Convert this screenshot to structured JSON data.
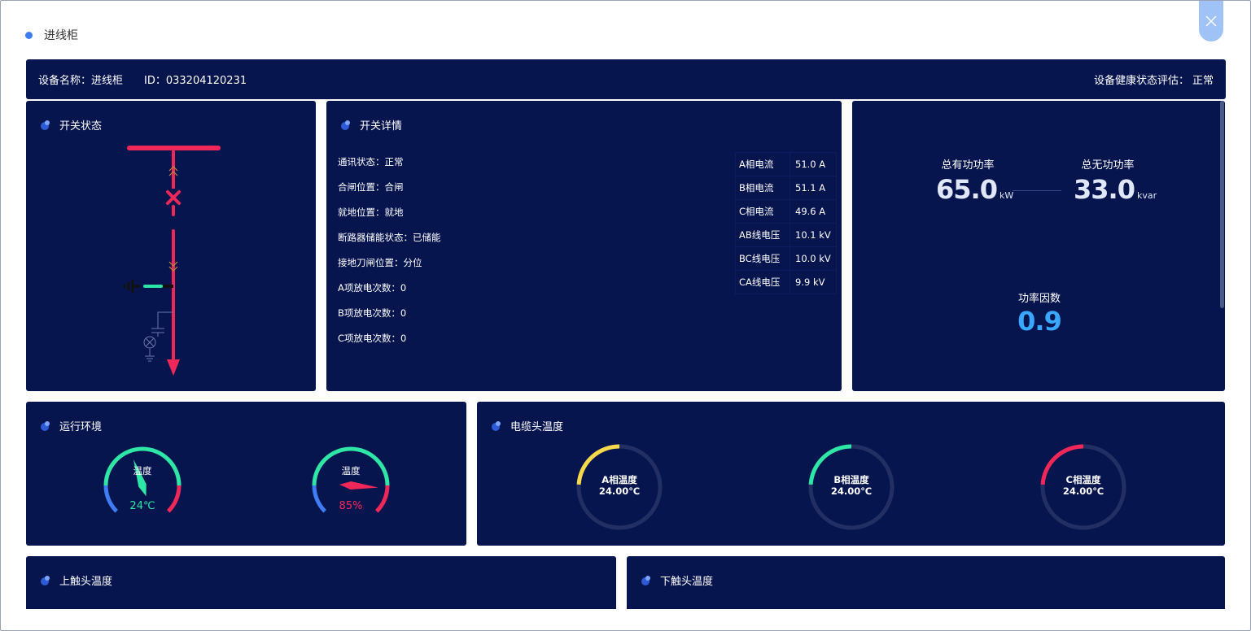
{
  "dialog": {
    "title": "进线柜",
    "close_icon": "close-icon"
  },
  "info_bar": {
    "device_name_label": "设备名称：进线柜",
    "id_label": "ID：033204120231",
    "health_label": "设备健康状态评估：",
    "health_value": "正常"
  },
  "switch_status": {
    "title": "开关状态"
  },
  "switch_detail": {
    "title": "开关详情",
    "status_items": [
      "通讯状态：正常",
      "合闸位置：合闸",
      "就地位置：就地",
      "断路器储能状态：已储能",
      "接地刀闸位置：分位",
      "A项放电次数：0",
      "B项放电次数：0",
      "C项放电次数：0"
    ],
    "meters": [
      {
        "label": "A相电流",
        "value": "51.0 A"
      },
      {
        "label": "B相电流",
        "value": "51.1 A"
      },
      {
        "label": "C相电流",
        "value": "49.6 A"
      },
      {
        "label": "AB线电压",
        "value": "10.1 kV"
      },
      {
        "label": "BC线电压",
        "value": "10.0 kV"
      },
      {
        "label": "CA线电压",
        "value": "9.9 kV"
      }
    ]
  },
  "power": {
    "active_label": "总有功功率",
    "active_value": "65.0",
    "active_unit": "kW",
    "reactive_label": "总无功功率",
    "reactive_value": "33.0",
    "reactive_unit": "kvar",
    "pf_label": "功率因数",
    "pf_value": "0.9"
  },
  "environment": {
    "title": "运行环境",
    "gauges": [
      {
        "label": "温度",
        "value": "24℃",
        "value_color": "#2ee6a6",
        "needle_color": "#2ee6a6",
        "level": 0.43
      },
      {
        "label": "温度",
        "value": "85%",
        "value_color": "#f0285a",
        "needle_color": "#f0285a",
        "level": 0.85
      }
    ]
  },
  "cable_temp": {
    "title": "电缆头温度",
    "rings": [
      {
        "name": "A相温度",
        "value": "24.00℃",
        "color": "#f5d94a",
        "fraction": 0.24
      },
      {
        "name": "B相温度",
        "value": "24.00℃",
        "color": "#2ee6a6",
        "fraction": 0.24
      },
      {
        "name": "C相温度",
        "value": "24.00℃",
        "color": "#f0285a",
        "fraction": 0.24
      }
    ]
  },
  "upper_contact": {
    "title": "上触头温度"
  },
  "lower_contact": {
    "title": "下触头温度"
  },
  "colors": {
    "panel": "#07154f",
    "accent_blue": "#3d7df5",
    "pf_blue": "#3aa7ff",
    "alarm_red": "#f0285a",
    "ok_green": "#2ee6a6"
  }
}
